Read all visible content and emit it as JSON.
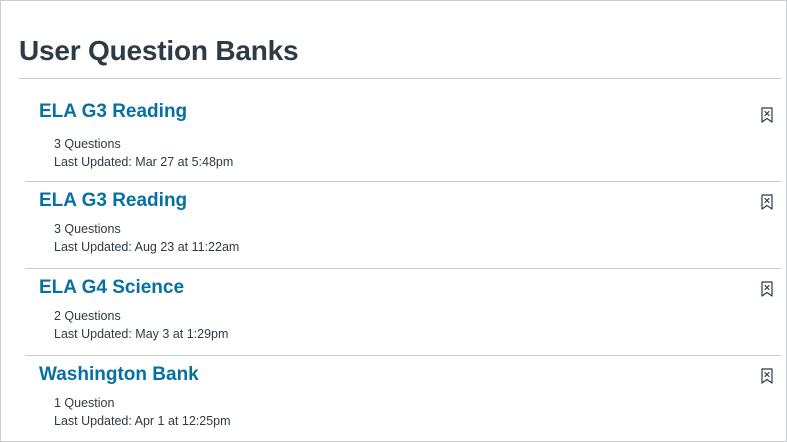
{
  "page": {
    "title": "User Question Banks"
  },
  "banks": [
    {
      "title": "ELA G3 Reading",
      "count": "3 Questions",
      "updated": "Last Updated: Mar 27 at 5:48pm",
      "icon": "bookmark-remove-icon"
    },
    {
      "title": "ELA G3 Reading",
      "count": "3 Questions",
      "updated": "Last Updated: Aug 23 at 11:22am",
      "icon": "bookmark-remove-icon"
    },
    {
      "title": "ELA G4 Science",
      "count": "2 Questions",
      "updated": "Last Updated: May 3 at 1:29pm",
      "icon": "bookmark-remove-icon"
    },
    {
      "title": "Washington Bank",
      "count": "1 Question",
      "updated": "Last Updated: Apr 1 at 12:25pm",
      "icon": "bookmark-remove-icon"
    }
  ],
  "colors": {
    "link": "#0770a3",
    "text": "#2d3b45",
    "divider": "#c7cdd1"
  }
}
